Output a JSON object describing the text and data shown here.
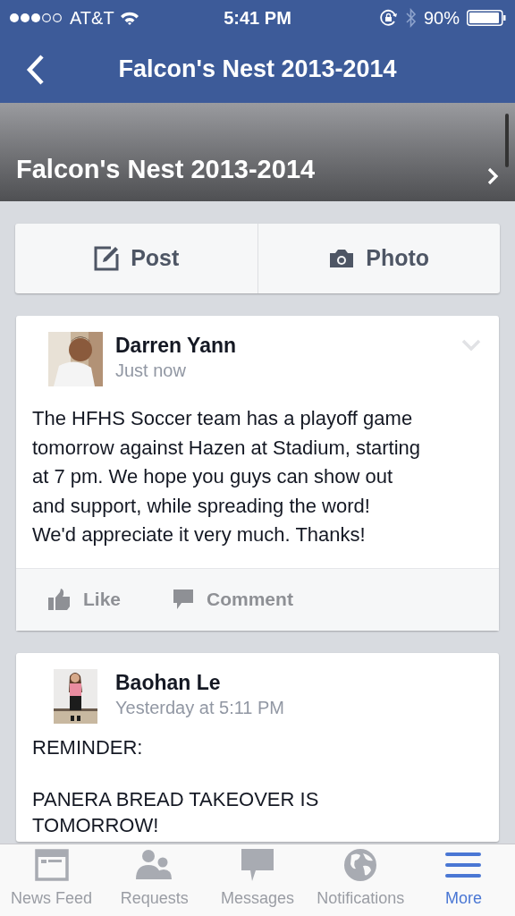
{
  "status_bar": {
    "carrier": "AT&T",
    "time": "5:41 PM",
    "battery": "90%"
  },
  "nav_bar": {
    "title": "Falcon's Nest 2013-2014"
  },
  "cover": {
    "title": "Falcon's Nest 2013-2014"
  },
  "composer": [
    {
      "kind": "post",
      "label": "Post"
    },
    {
      "label": "Photo"
    }
  ],
  "posts": [
    {
      "author": "Darren Yann",
      "time": "Just now",
      "text": "The HFHS Soccer team has a playoff game\ntomorrow against Hazen at Stadium, starting\nat 7 pm. We hope you guys can show out\nand support, while spreading the word!\nWe'd appreciate it very much. Thanks!",
      "menu": true,
      "actions": [
        {
          "kind": "like",
          "label": "Like"
        },
        {
          "kind": "comment",
          "label": "Comment"
        }
      ]
    },
    {
      "author": "Baohan Le",
      "time": "Yesterday at 5:11 PM",
      "text": "REMINDER:\n\nPANERA BREAD TAKEOVER IS\nTOMORROW!",
      "menu": false
    }
  ],
  "tab_bar": [
    {
      "kind": "feed",
      "label": "News Feed",
      "selected": false
    },
    {
      "kind": "requests",
      "label": "Requests",
      "selected": false
    },
    {
      "kind": "messages",
      "label": "Messages",
      "selected": false
    },
    {
      "kind": "notifications",
      "label": "Notifications",
      "selected": false
    },
    {
      "kind": "more",
      "label": "More",
      "selected": true
    }
  ]
}
